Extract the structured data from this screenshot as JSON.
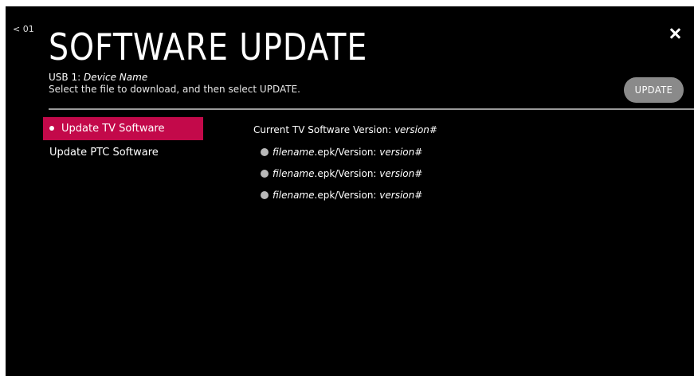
{
  "header": {
    "back_label": "< 01",
    "title": "SOFTWARE UPDATE",
    "usb_prefix": "USB 1: ",
    "usb_device": "Device Name",
    "instruction": "Select the file to download, and then select UPDATE.",
    "update_button": "UPDATE"
  },
  "menu": {
    "items": [
      {
        "label": "Update TV Software",
        "active": true
      },
      {
        "label": "Update PTC Software",
        "active": false
      }
    ]
  },
  "content": {
    "current_label": "Current TV Software Version: ",
    "current_version": "version#",
    "files": [
      {
        "name": "filename",
        "ext": ".epk/Version: ",
        "version": "version#"
      },
      {
        "name": "filename",
        "ext": ".epk/Version: ",
        "version": "version#"
      },
      {
        "name": "filename",
        "ext": ".epk/Version: ",
        "version": "version#"
      }
    ]
  },
  "colors": {
    "background": "#000000",
    "accent": "#c3094a",
    "button": "#8a8a8a",
    "radio": "#b8b8b8"
  },
  "icons": {
    "close": "close-icon",
    "bullet": "bullet-dot-icon",
    "radio": "radio-icon"
  }
}
